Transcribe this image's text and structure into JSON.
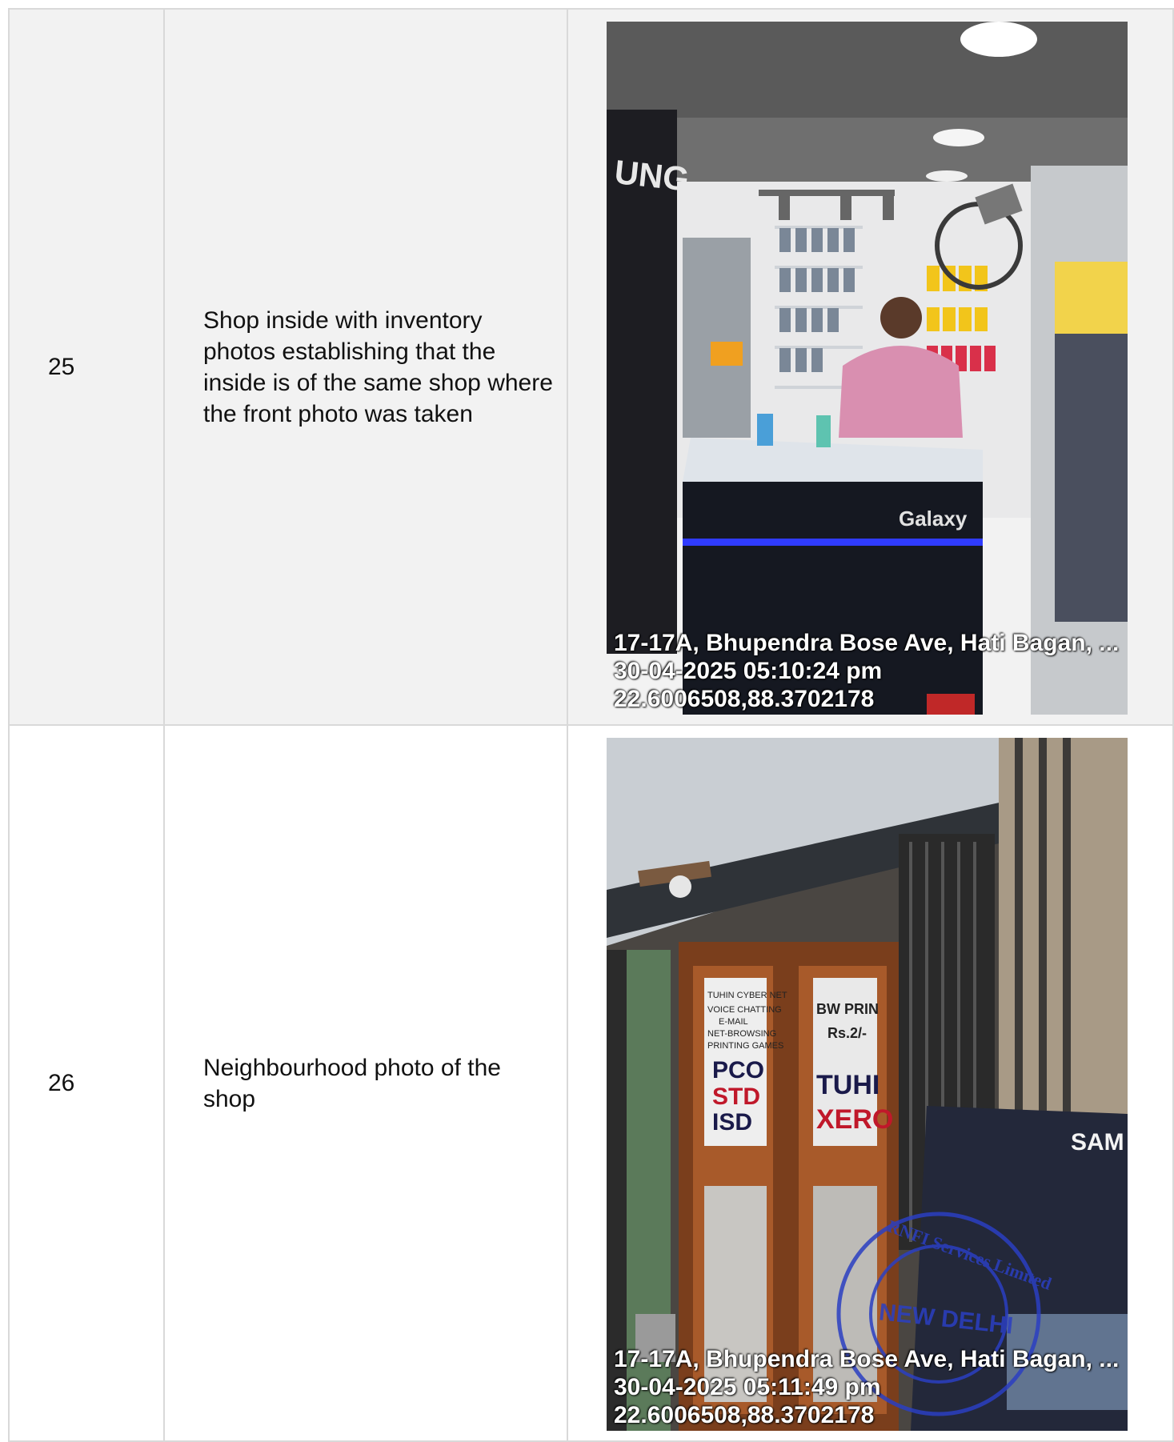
{
  "rows": [
    {
      "number": "25",
      "description": "Shop inside with inventory photos establishing that the inside is of the same shop where the front photo was taken",
      "photo": {
        "subject": "shop interior with shopkeeper behind Galaxy counter",
        "sign_text": "Galaxy",
        "brand_fragment": "UNG",
        "address": "17-17A, Bhupendra Bose Ave, Hati Bagan, ...",
        "datetime": "30-04-2025 05:10:24 pm",
        "coordinates": "22.6006508,88.3702178"
      }
    },
    {
      "number": "26",
      "description": "Neighbourhood photo of the shop",
      "photo": {
        "subject": "neighbouring cyber cafe doors and Samsung display",
        "door_sign_lines": [
          "TUHIN CYBER NET",
          "VOICE CHATTING",
          "E-MAIL",
          "NET-BROWSING",
          "PRINTING GAMES",
          "PCO",
          "STD",
          "ISD"
        ],
        "door_sign2_lines": [
          "BW PRIN",
          "Rs.2/-",
          "TUHI",
          "XERO"
        ],
        "brand_fragment": "SAM",
        "stamp_text": "RNFI Services Limited",
        "stamp_center": "NEW DELHI",
        "address": "17-17A, Bhupendra Bose Ave, Hati Bagan, ...",
        "datetime": "30-04-2025 05:11:49 pm",
        "coordinates": "22.6006508,88.3702178"
      }
    }
  ]
}
